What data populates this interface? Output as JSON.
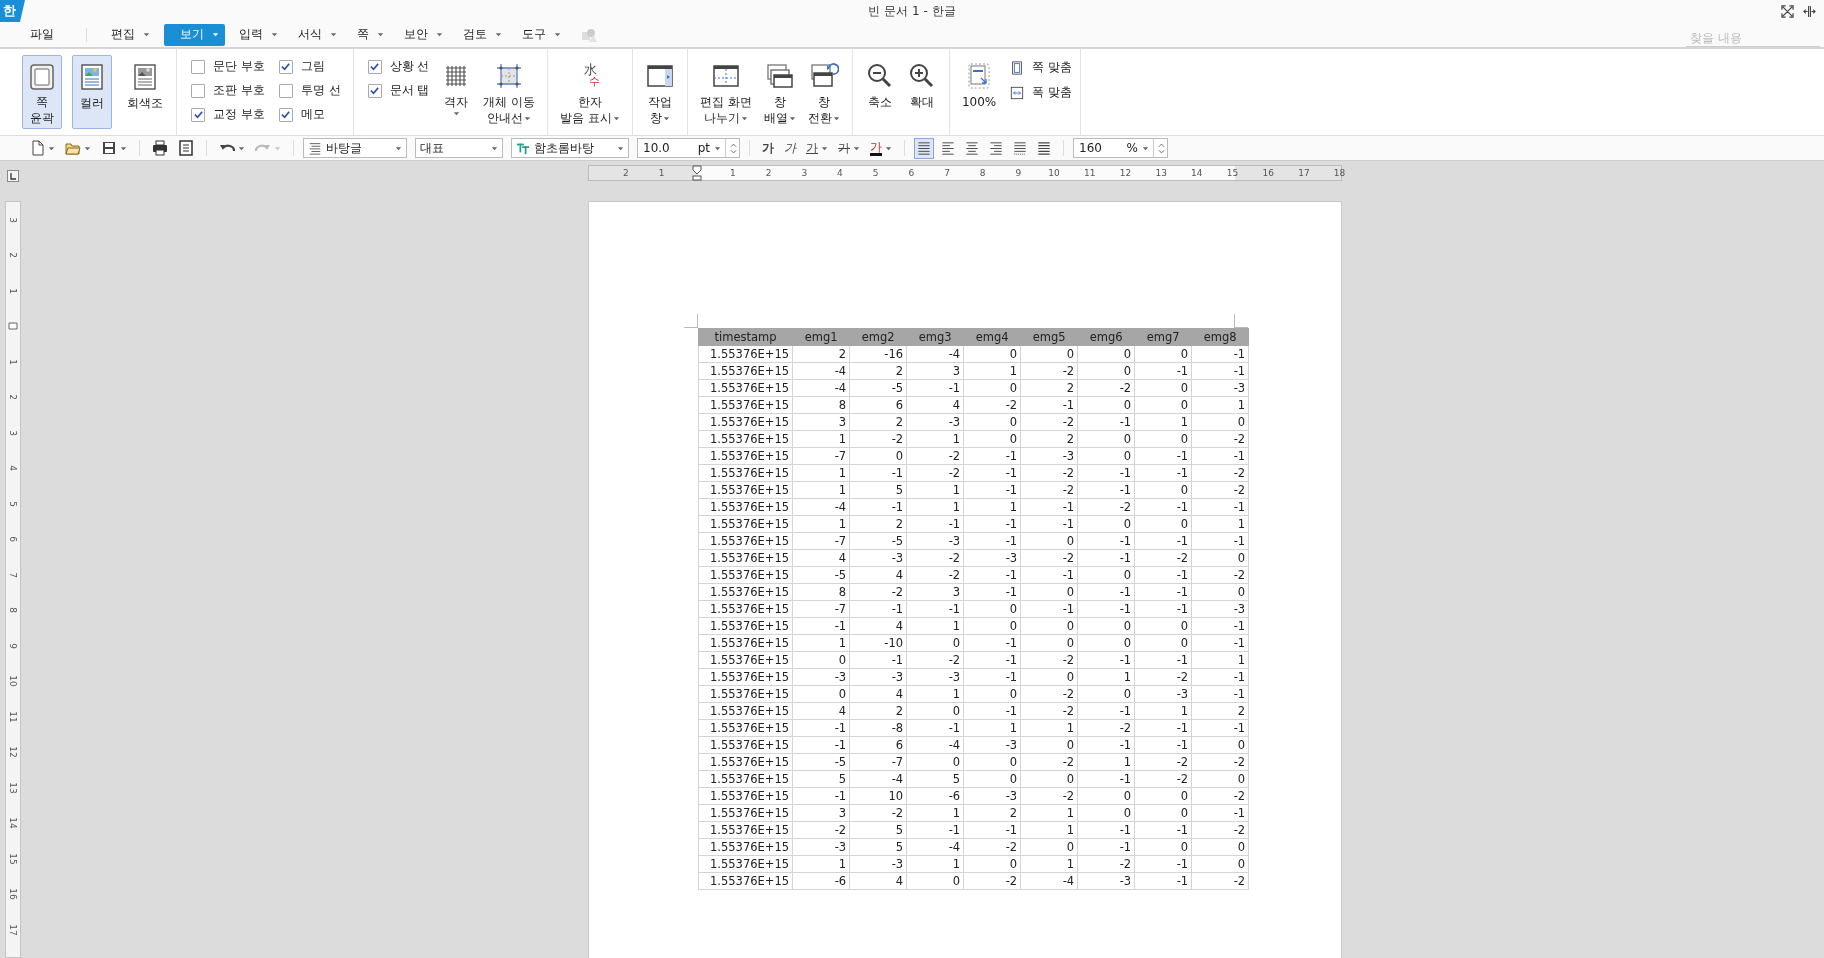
{
  "window": {
    "logo": "한",
    "title": "빈 문서 1 - 한글"
  },
  "menu": [
    {
      "label": "파일",
      "selected": false,
      "dropdown": false
    },
    {
      "label": "편집",
      "selected": false,
      "dropdown": true
    },
    {
      "label": "보기",
      "selected": true,
      "dropdown": true
    },
    {
      "label": "입력",
      "selected": false,
      "dropdown": true
    },
    {
      "label": "서식",
      "selected": false,
      "dropdown": true
    },
    {
      "label": "쪽",
      "selected": false,
      "dropdown": true
    },
    {
      "label": "보안",
      "selected": false,
      "dropdown": true
    },
    {
      "label": "검토",
      "selected": false,
      "dropdown": true
    },
    {
      "label": "도구",
      "selected": false,
      "dropdown": true
    }
  ],
  "search": {
    "placeholder": "찾을 내용"
  },
  "ribbon": {
    "groups": [
      {
        "items": [
          {
            "kind": "big",
            "lines": [
              "쪽",
              "윤곽"
            ],
            "selected": true
          },
          {
            "kind": "big",
            "lines": [
              "컬러"
            ],
            "selected": true
          },
          {
            "kind": "big",
            "lines": [
              "회색조"
            ],
            "selected": false
          }
        ]
      },
      {
        "items": [
          {
            "kind": "checks",
            "columns": [
              [
                {
                  "label": "문단 부호",
                  "checked": false
                },
                {
                  "label": "조판 부호",
                  "checked": false
                },
                {
                  "label": "교정 부호",
                  "checked": true
                }
              ],
              [
                {
                  "label": "그림",
                  "checked": true
                },
                {
                  "label": "투명 선",
                  "checked": false
                },
                {
                  "label": "메모",
                  "checked": true
                }
              ]
            ]
          }
        ]
      },
      {
        "items": [
          {
            "kind": "checks",
            "columns": [
              [
                {
                  "label": "상황 선",
                  "checked": true
                },
                {
                  "label": "문서 탭",
                  "checked": true
                }
              ]
            ]
          },
          {
            "kind": "big",
            "lines": [
              "격자"
            ],
            "dropdown": true
          },
          {
            "kind": "big",
            "lines": [
              "개체 이동",
              "안내선"
            ],
            "dropdown": true
          }
        ]
      },
      {
        "items": [
          {
            "kind": "big",
            "glyphs": [
              "水",
              "수"
            ],
            "lines": [
              "한자",
              "발음 표시"
            ],
            "dropdown": true
          }
        ]
      },
      {
        "items": [
          {
            "kind": "big",
            "lines": [
              "작업",
              "창"
            ],
            "dropdown": true
          }
        ]
      },
      {
        "items": [
          {
            "kind": "big",
            "lines": [
              "편집 화면",
              "나누기"
            ],
            "dropdown": true
          },
          {
            "kind": "big",
            "lines": [
              "창",
              "배열"
            ],
            "dropdown": true
          },
          {
            "kind": "big",
            "lines": [
              "창",
              "전환"
            ],
            "dropdown": true
          }
        ]
      },
      {
        "items": [
          {
            "kind": "big",
            "lines": [
              "축소"
            ]
          },
          {
            "kind": "big",
            "lines": [
              "확대"
            ]
          }
        ]
      },
      {
        "items": [
          {
            "kind": "big",
            "lines": [
              "100%"
            ]
          },
          {
            "kind": "smalls",
            "items": [
              {
                "label": "쪽 맞춤"
              },
              {
                "label": "폭 맞춤"
              }
            ]
          }
        ]
      }
    ]
  },
  "toolbar": [
    {
      "kind": "icon",
      "dropdown": true,
      "disabled": false
    },
    {
      "kind": "icon",
      "dropdown": true,
      "disabled": false
    },
    {
      "kind": "icon",
      "dropdown": true,
      "disabled": false
    },
    {
      "kind": "sep"
    },
    {
      "kind": "icon",
      "dropdown": false,
      "disabled": false
    },
    {
      "kind": "icon",
      "dropdown": false,
      "disabled": false
    },
    {
      "kind": "sep"
    },
    {
      "kind": "icon",
      "dropdown": true,
      "disabled": false
    },
    {
      "kind": "icon",
      "dropdown": true,
      "disabled": true
    },
    {
      "kind": "sep"
    },
    {
      "kind": "combo",
      "value": "바탕글"
    },
    {
      "kind": "combo",
      "value": "대표"
    },
    {
      "kind": "combo",
      "value": "함초롬바탕"
    },
    {
      "kind": "spin",
      "value": "10.0",
      "unit": "pt"
    },
    {
      "kind": "sep"
    },
    {
      "kind": "glyph",
      "text": "가",
      "dropdown": false
    },
    {
      "kind": "glyph",
      "text": "가",
      "dropdown": false
    },
    {
      "kind": "glyph",
      "text": "가",
      "dropdown": true
    },
    {
      "kind": "glyph",
      "text": "가",
      "dropdown": true
    },
    {
      "kind": "glyph",
      "text": "가",
      "dropdown": true
    },
    {
      "kind": "sep"
    },
    {
      "kind": "align",
      "selected": true
    },
    {
      "kind": "align",
      "selected": false
    },
    {
      "kind": "align",
      "selected": false
    },
    {
      "kind": "align",
      "selected": false
    },
    {
      "kind": "align",
      "selected": false
    },
    {
      "kind": "align",
      "selected": false
    },
    {
      "kind": "sep"
    },
    {
      "kind": "spin",
      "value": "160",
      "unit": "%"
    }
  ],
  "ruler": {
    "left_labels": [
      "2",
      "1"
    ],
    "right_labels": [
      "1",
      "2",
      "3",
      "4",
      "5",
      "6",
      "7",
      "8",
      "9",
      "10",
      "11",
      "12",
      "13",
      "14",
      "15",
      "16",
      "17",
      "18"
    ]
  },
  "vertical_ruler": {
    "top_labels": [
      "3",
      "2",
      "1"
    ],
    "bottom_labels": [
      "1",
      "2",
      "3",
      "4",
      "5",
      "6",
      "7",
      "8",
      "9",
      "10",
      "11",
      "12",
      "13",
      "14",
      "15",
      "16",
      "17"
    ]
  },
  "table": {
    "columns": [
      "timestamp",
      "emg1",
      "emg2",
      "emg3",
      "emg4",
      "emg5",
      "emg6",
      "emg7",
      "emg8"
    ],
    "rows": [
      [
        "1.55376E+15",
        "2",
        "-16",
        "-4",
        "0",
        "0",
        "0",
        "0",
        "-1"
      ],
      [
        "1.55376E+15",
        "-4",
        "2",
        "3",
        "1",
        "-2",
        "0",
        "-1",
        "-1"
      ],
      [
        "1.55376E+15",
        "-4",
        "-5",
        "-1",
        "0",
        "2",
        "-2",
        "0",
        "-3"
      ],
      [
        "1.55376E+15",
        "8",
        "6",
        "4",
        "-2",
        "-1",
        "0",
        "0",
        "1"
      ],
      [
        "1.55376E+15",
        "3",
        "2",
        "-3",
        "0",
        "-2",
        "-1",
        "1",
        "0"
      ],
      [
        "1.55376E+15",
        "1",
        "-2",
        "1",
        "0",
        "2",
        "0",
        "0",
        "-2"
      ],
      [
        "1.55376E+15",
        "-7",
        "0",
        "-2",
        "-1",
        "-3",
        "0",
        "-1",
        "-1"
      ],
      [
        "1.55376E+15",
        "1",
        "-1",
        "-2",
        "-1",
        "-2",
        "-1",
        "-1",
        "-2"
      ],
      [
        "1.55376E+15",
        "1",
        "5",
        "1",
        "-1",
        "-2",
        "-1",
        "0",
        "-2"
      ],
      [
        "1.55376E+15",
        "-4",
        "-1",
        "1",
        "1",
        "-1",
        "-2",
        "-1",
        "-1"
      ],
      [
        "1.55376E+15",
        "1",
        "2",
        "-1",
        "-1",
        "-1",
        "0",
        "0",
        "1"
      ],
      [
        "1.55376E+15",
        "-7",
        "-5",
        "-3",
        "-1",
        "0",
        "-1",
        "-1",
        "-1"
      ],
      [
        "1.55376E+15",
        "4",
        "-3",
        "-2",
        "-3",
        "-2",
        "-1",
        "-2",
        "0"
      ],
      [
        "1.55376E+15",
        "-5",
        "4",
        "-2",
        "-1",
        "-1",
        "0",
        "-1",
        "-2"
      ],
      [
        "1.55376E+15",
        "8",
        "-2",
        "3",
        "-1",
        "0",
        "-1",
        "-1",
        "0"
      ],
      [
        "1.55376E+15",
        "-7",
        "-1",
        "-1",
        "0",
        "-1",
        "-1",
        "-1",
        "-3"
      ],
      [
        "1.55376E+15",
        "-1",
        "4",
        "1",
        "0",
        "0",
        "0",
        "0",
        "-1"
      ],
      [
        "1.55376E+15",
        "1",
        "-10",
        "0",
        "-1",
        "0",
        "0",
        "0",
        "-1"
      ],
      [
        "1.55376E+15",
        "0",
        "-1",
        "-2",
        "-1",
        "-2",
        "-1",
        "-1",
        "1"
      ],
      [
        "1.55376E+15",
        "-3",
        "-3",
        "-3",
        "-1",
        "0",
        "1",
        "-2",
        "-1"
      ],
      [
        "1.55376E+15",
        "0",
        "4",
        "1",
        "0",
        "-2",
        "0",
        "-3",
        "-1"
      ],
      [
        "1.55376E+15",
        "4",
        "2",
        "0",
        "-1",
        "-2",
        "-1",
        "1",
        "2"
      ],
      [
        "1.55376E+15",
        "-1",
        "-8",
        "-1",
        "1",
        "1",
        "-2",
        "-1",
        "-1"
      ],
      [
        "1.55376E+15",
        "-1",
        "6",
        "-4",
        "-3",
        "0",
        "-1",
        "-1",
        "0"
      ],
      [
        "1.55376E+15",
        "-5",
        "-7",
        "0",
        "0",
        "-2",
        "1",
        "-2",
        "-2"
      ],
      [
        "1.55376E+15",
        "5",
        "-4",
        "5",
        "0",
        "0",
        "-1",
        "-2",
        "0"
      ],
      [
        "1.55376E+15",
        "-1",
        "10",
        "-6",
        "-3",
        "-2",
        "0",
        "0",
        "-2"
      ],
      [
        "1.55376E+15",
        "3",
        "-2",
        "1",
        "2",
        "1",
        "0",
        "0",
        "-1"
      ],
      [
        "1.55376E+15",
        "-2",
        "5",
        "-1",
        "-1",
        "1",
        "-1",
        "-1",
        "-2"
      ],
      [
        "1.55376E+15",
        "-3",
        "5",
        "-4",
        "-2",
        "0",
        "-1",
        "0",
        "0"
      ],
      [
        "1.55376E+15",
        "1",
        "-3",
        "1",
        "0",
        "1",
        "-2",
        "-1",
        "0"
      ],
      [
        "1.55376E+15",
        "-6",
        "4",
        "0",
        "-2",
        "-4",
        "-3",
        "-1",
        "-2"
      ]
    ]
  }
}
